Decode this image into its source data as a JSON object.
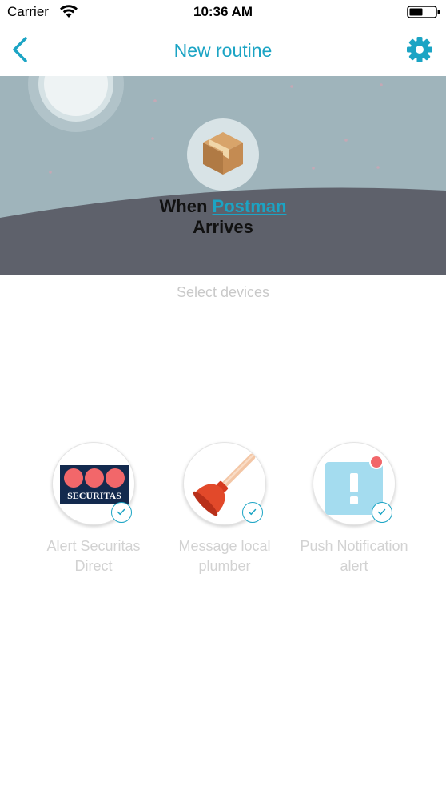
{
  "status_bar": {
    "carrier": "Carrier",
    "time": "10:36 AM",
    "icons": [
      "wifi-icon",
      "battery-icon"
    ]
  },
  "nav": {
    "title": "New routine",
    "back_icon": "chevron-left-icon",
    "settings_icon": "gear-icon"
  },
  "hero": {
    "title_prefix": "When",
    "trigger": "Postman",
    "title_suffix": "Arrives",
    "icon": "package-icon"
  },
  "section_label": "Select devices",
  "devices": [
    {
      "line1": "Alert Securitas",
      "line2": "Direct",
      "logo_text": "SECURITAS",
      "icon": "securitas-logo",
      "selected": true
    },
    {
      "line1": "Message local",
      "line2": "plumber",
      "icon": "plunger-icon",
      "selected": true
    },
    {
      "line1": "Push Notification",
      "line2": "alert",
      "icon": "notification-alert-icon",
      "selected": true
    }
  ],
  "colors": {
    "accent": "#1ba4c4",
    "hero_sky": "#9fb4bb",
    "hero_ground": "#5e616b",
    "label_gray": "#d2d2d2"
  }
}
